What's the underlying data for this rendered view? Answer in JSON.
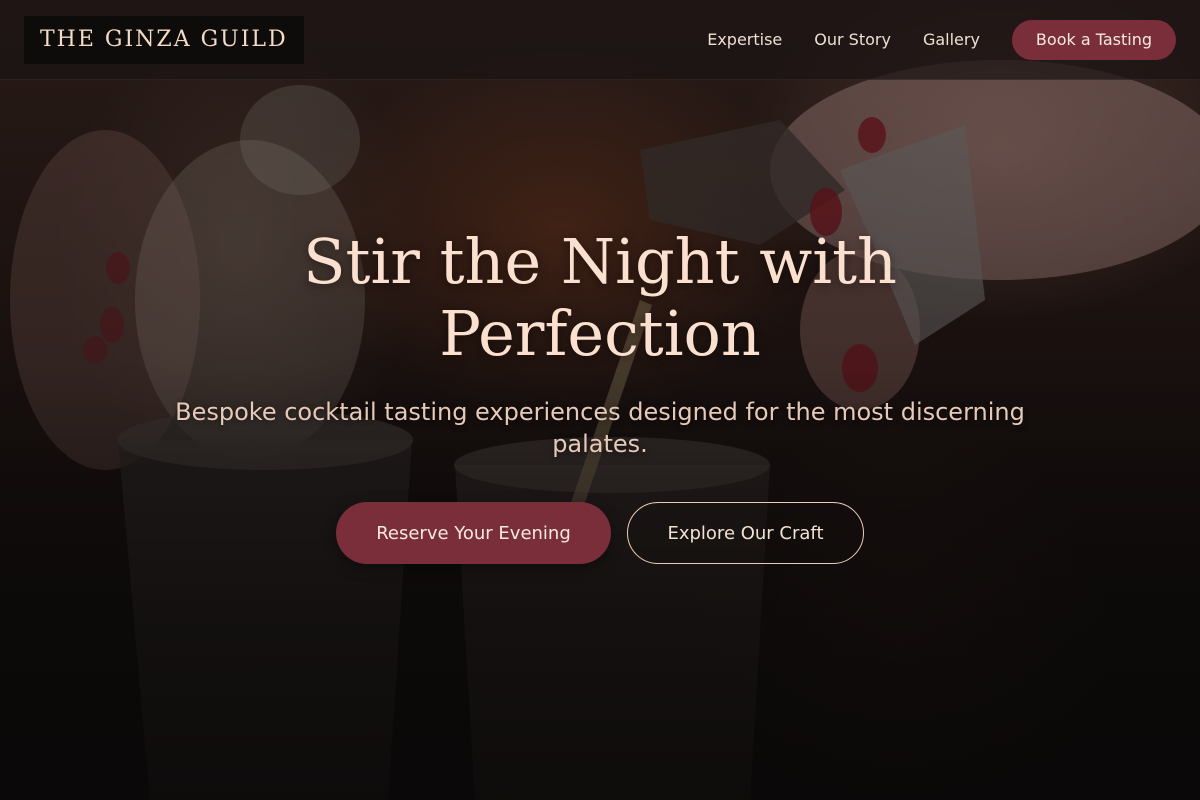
{
  "brand": {
    "name": "THE GINZA GUILD"
  },
  "nav": {
    "links": [
      {
        "label": "Expertise"
      },
      {
        "label": "Our Story"
      },
      {
        "label": "Gallery"
      }
    ],
    "cta_label": "Book a Tasting"
  },
  "hero": {
    "title": "Stir the Night with Perfection",
    "subtitle": "Bespoke cocktail tasting experiences designed for the most discerning palates.",
    "primary_button": "Reserve Your Evening",
    "secondary_button": "Explore Our Craft"
  },
  "colors": {
    "accent": "#7a2e3a",
    "title": "#fbe0cf",
    "text": "#eedfd2",
    "header_bg": "#1a1413"
  }
}
